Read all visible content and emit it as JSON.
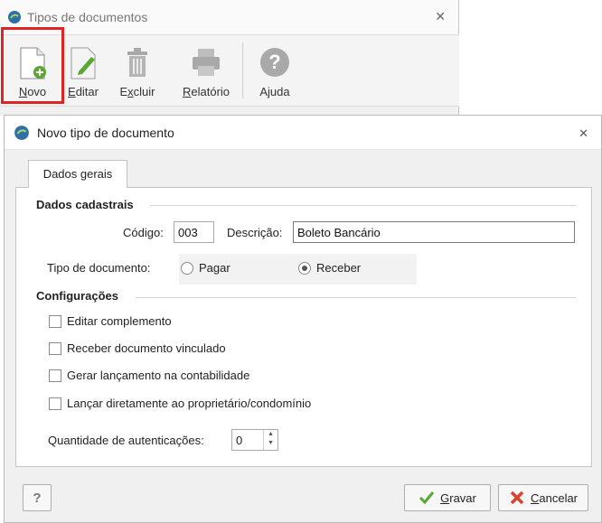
{
  "bg_window": {
    "title": "Tipos de documentos",
    "toolbar": [
      {
        "key": "N",
        "rest": "ovo"
      },
      {
        "key": "E",
        "rest": "ditar"
      },
      {
        "key": "",
        "pre": "E",
        "keyc": "x",
        "rest": "cluir"
      },
      {
        "key": "R",
        "rest": "elatório"
      },
      {
        "plain": "Ajuda"
      }
    ]
  },
  "dialog": {
    "title": "Novo tipo de documento",
    "tab": "Dados gerais",
    "section1": "Dados cadastrais",
    "codigo_label": "Código:",
    "codigo_value": "003",
    "descricao_label": "Descrição:",
    "descricao_value": "Boleto Bancário",
    "tipo_label": "Tipo de documento:",
    "radio_pagar": "Pagar",
    "radio_receber": "Receber",
    "section2": "Configurações",
    "checks": [
      "Editar complemento",
      "Receber documento vinculado",
      "Gerar lançamento na contabilidade",
      "Lançar diretamente ao proprietário/condomínio"
    ],
    "autentic_label": "Quantidade de autenticações:",
    "autentic_value": "0",
    "help_btn": "?",
    "gravar": {
      "key": "G",
      "rest": "ravar"
    },
    "cancelar": {
      "key": "C",
      "rest": "ancelar"
    }
  },
  "colors": {
    "highlight": "#e02424",
    "accent_green": "#5aa832",
    "cancel_red": "#d6452e"
  }
}
